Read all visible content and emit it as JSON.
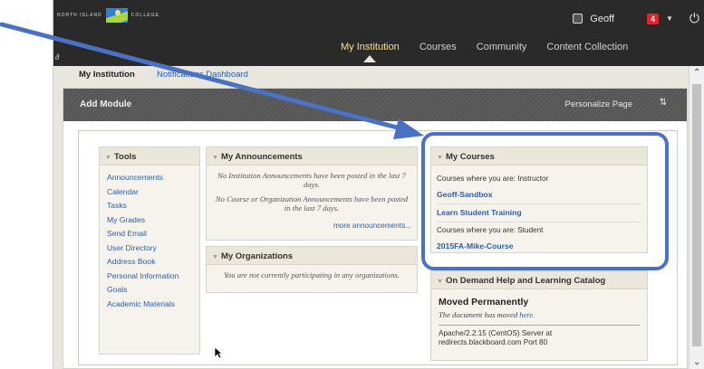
{
  "header": {
    "logo_text_left": "NORTH ISLAND",
    "logo_text_right": "COLLEGE",
    "user_name": "Geoff",
    "notification_count": "4",
    "nav": [
      "My Institution",
      "Courses",
      "Community",
      "Content Collection"
    ],
    "active_nav_index": 0
  },
  "tabs": {
    "active": "My Institution",
    "second": "Notifications Dashboard"
  },
  "module_bar": {
    "add_module": "Add Module",
    "personalize": "Personalize Page"
  },
  "tools": {
    "title": "Tools",
    "links": [
      "Announcements",
      "Calendar",
      "Tasks",
      "My Grades",
      "Send Email",
      "User Directory",
      "Address Book",
      "Personal Information",
      "Goals",
      "Academic Materials"
    ]
  },
  "announcements": {
    "title": "My Announcements",
    "line1": "No Institution Announcements have been posted in the last 7 days.",
    "line2": "No Course or Organization Announcements have been posted in the last 7 days.",
    "more": "more announcements..."
  },
  "organizations": {
    "title": "My Organizations",
    "text": "You are not currently participating in any organizations."
  },
  "courses": {
    "title": "My Courses",
    "instructor_label": "Courses where you are: Instructor",
    "instructor_courses": [
      "Geoff-Sandbox",
      "Learn Student Training"
    ],
    "student_label": "Courses where you are: Student",
    "student_courses": [
      "2015FA-Mike-Course"
    ]
  },
  "help": {
    "title": "On Demand Help and Learning Catalog",
    "moved_title": "Moved Permanently",
    "moved_text": "The document has moved",
    "moved_link": "here.",
    "server_line1": "Apache/2.2.15 (CentOS) Server at",
    "server_line2": "redirects.blackboard.com Port 80"
  },
  "colors": {
    "annotation": "#4a72c4",
    "link": "#2a5fb2",
    "header_bg": "#2a2a2a",
    "active_nav": "#f7e27d"
  }
}
